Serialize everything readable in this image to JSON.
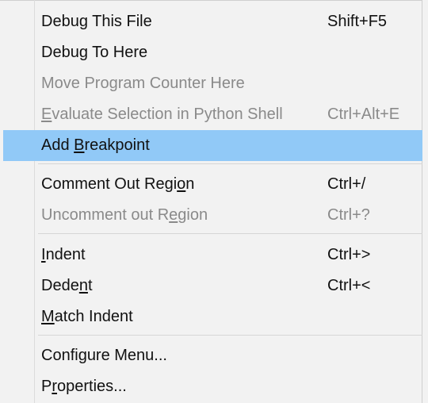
{
  "menu": {
    "items": [
      {
        "id": "debug-this-file",
        "label": "Debug This File",
        "shortcut": "Shift+F5",
        "enabled": true
      },
      {
        "id": "debug-to-here",
        "label": "Debug To Here",
        "shortcut": "",
        "enabled": true
      },
      {
        "id": "move-program-counter-here",
        "label": "Move Program Counter Here",
        "shortcut": "",
        "enabled": false
      },
      {
        "id": "evaluate-selection",
        "label": "Evaluate Selection in Python Shell",
        "shortcut": "Ctrl+Alt+E",
        "enabled": false
      },
      {
        "id": "add-breakpoint",
        "label": "Add Breakpoint",
        "shortcut": "",
        "enabled": true,
        "highlighted": true
      },
      {
        "id": "comment-out-region",
        "label": "Comment Out Region",
        "shortcut": "Ctrl+/",
        "enabled": true
      },
      {
        "id": "uncomment-out-region",
        "label": "Uncomment out Region",
        "shortcut": "Ctrl+?",
        "enabled": false
      },
      {
        "id": "indent",
        "label": "Indent",
        "shortcut": "Ctrl+>",
        "enabled": true
      },
      {
        "id": "dedent",
        "label": "Dedent",
        "shortcut": "Ctrl+<",
        "enabled": true
      },
      {
        "id": "match-indent",
        "label": "Match Indent",
        "shortcut": "",
        "enabled": true
      },
      {
        "id": "configure-menu",
        "label": "Configure Menu...",
        "shortcut": "",
        "enabled": true
      },
      {
        "id": "properties",
        "label": "Properties...",
        "shortcut": "",
        "enabled": true
      }
    ]
  },
  "colors": {
    "menu_background": "#f2f2f2",
    "highlight": "#91c9f7",
    "enabled_text": "#111111",
    "disabled_text": "#8a8a8a",
    "separator": "#d6d6d6"
  }
}
